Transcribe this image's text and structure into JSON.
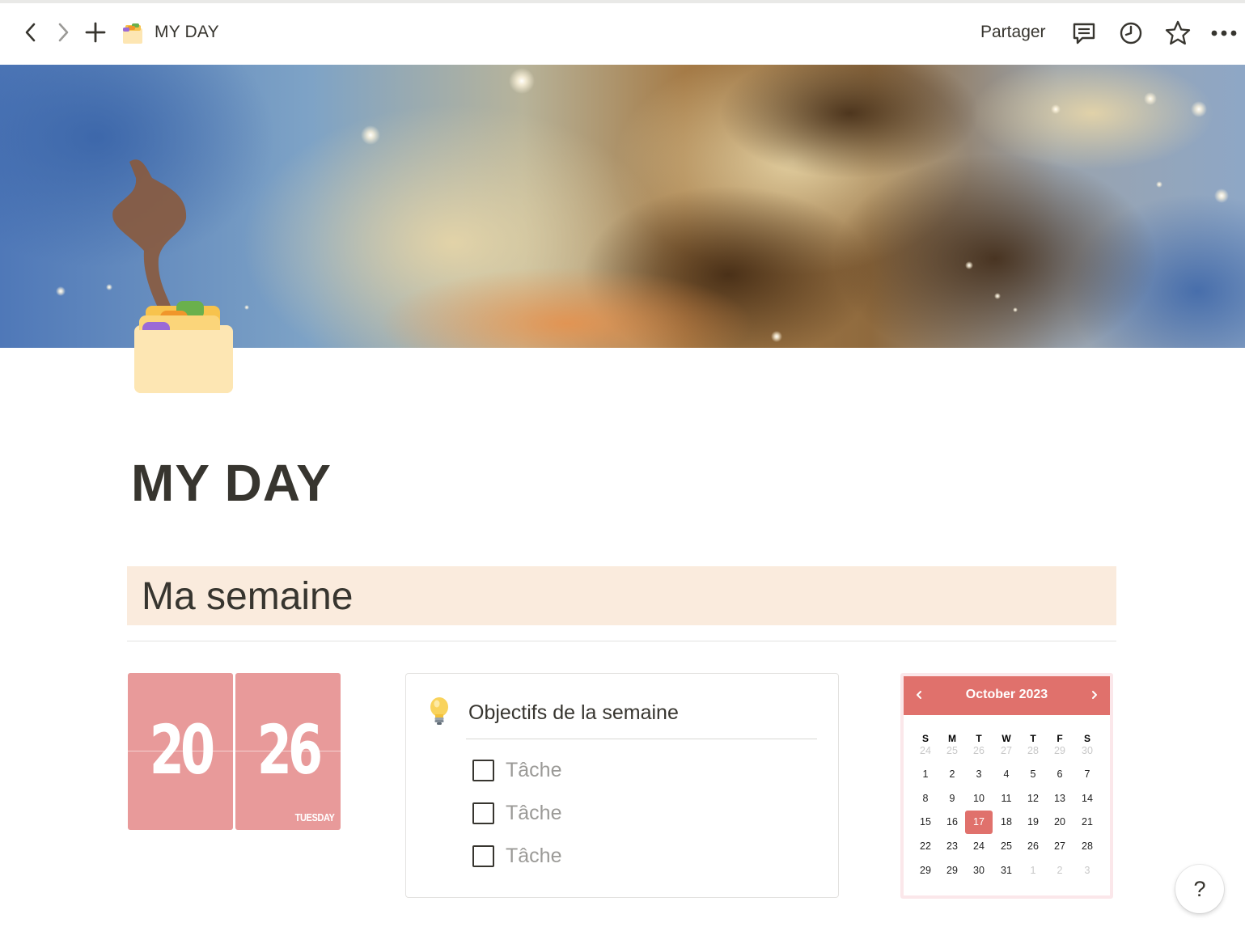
{
  "topbar": {
    "breadcrumb_title": "MY DAY",
    "share_label": "Partager",
    "icons": [
      "back-arrow-icon",
      "forward-arrow-icon",
      "plus-icon",
      "comment-icon",
      "clock-history-icon",
      "star-icon",
      "more-icon"
    ]
  },
  "page": {
    "title": "MY DAY",
    "icon": "card-index-folder-icon"
  },
  "section": {
    "heading": "Ma semaine",
    "heading_bg": "#faebdd"
  },
  "clock": {
    "hours": "20",
    "minutes": "26",
    "day": "TUESDAY",
    "color": "#e89a9a"
  },
  "objectives": {
    "icon": "light-bulb-icon",
    "title": "Objectifs de la semaine",
    "tasks": [
      {
        "label": "Tâche",
        "checked": false
      },
      {
        "label": "Tâche",
        "checked": false
      },
      {
        "label": "Tâche",
        "checked": false
      }
    ]
  },
  "calendar": {
    "month_label": "October 2023",
    "accent": "#e0716c",
    "weekdays": [
      "S",
      "M",
      "T",
      "W",
      "T",
      "F",
      "S"
    ],
    "weeks": [
      [
        "24",
        "25",
        "26",
        "27",
        "28",
        "29",
        "30"
      ],
      [
        "1",
        "2",
        "3",
        "4",
        "5",
        "6",
        "7"
      ],
      [
        "8",
        "9",
        "10",
        "11",
        "12",
        "13",
        "14"
      ],
      [
        "15",
        "16",
        "17",
        "18",
        "19",
        "20",
        "21"
      ],
      [
        "22",
        "23",
        "24",
        "25",
        "26",
        "27",
        "28"
      ],
      [
        "29",
        "29",
        "30",
        "31",
        "1",
        "2",
        "3"
      ]
    ],
    "muted": [
      [
        0,
        0
      ],
      [
        0,
        1
      ],
      [
        0,
        2
      ],
      [
        0,
        3
      ],
      [
        0,
        4
      ],
      [
        0,
        5
      ],
      [
        0,
        6
      ],
      [
        5,
        4
      ],
      [
        5,
        5
      ],
      [
        5,
        6
      ]
    ],
    "today": "17"
  },
  "help": {
    "label": "?"
  }
}
